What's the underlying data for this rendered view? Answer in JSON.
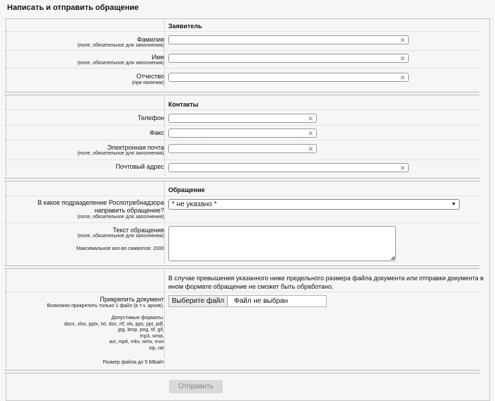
{
  "page": {
    "title": "Написать и отправить обращение"
  },
  "applicant": {
    "section_title": "Заявитель",
    "surname": {
      "label": "Фамилия",
      "note": "(поле, обязательное для заполнения)"
    },
    "name": {
      "label": "Имя",
      "note": "(поле, обязательное для заполнения)"
    },
    "patronymic": {
      "label": "Отчество",
      "note": "(при наличии)"
    }
  },
  "contacts": {
    "section_title": "Контакты",
    "phone": {
      "label": "Телефон"
    },
    "fax": {
      "label": "Факс"
    },
    "email": {
      "label": "Электронная почта",
      "note": "(поле, обязательное для заполнения)"
    },
    "postal": {
      "label": "Почтовый адрес"
    }
  },
  "appeal": {
    "section_title": "Обращение",
    "department": {
      "label_line1": "В какое подразделение Роспотребнадзора",
      "label_line2": "направить обращение?",
      "note": "(поле, обязательное для заполнения)",
      "selected_value": "* не указано *"
    },
    "text": {
      "label": "Текст обращения",
      "note": "(поле, обязательное для заполнения)",
      "max_chars": "Максимальное кол-во символов: 2000"
    }
  },
  "attachment": {
    "notice": "В случае превышения указанного ниже предельного размера файла документа или отправки документа в ином формате обращение не сможет быть обработано.",
    "label": "Прикрепить документ",
    "limit_note": "Возможно прикрепить только 1 файл (в т.ч. архив).",
    "formats_title": "Допустимые форматы:",
    "formats_lines": [
      "docx, xlsx, pptx, txt, doc, rtf, xls, pps, ppt, pdf,",
      "jpg, bmp, png, tif, gif,",
      "mp3, wma,",
      "avi, mp4, mkv, wmv, mov",
      "zip, rar"
    ],
    "max_size": "Размер файла до 5 МБайт",
    "choose_button": "Выберите файл",
    "no_file": "Файл не выбран"
  },
  "actions": {
    "submit": "Отправить"
  },
  "icons": {
    "clear": "clear-x-icon",
    "dropdown": "dropdown-arrow-icon",
    "resize": "resize-grip-icon"
  },
  "colors": {
    "background": "#f6f6f6",
    "border": "#c8c8c8",
    "button_disabled": "#d9d9d9"
  }
}
